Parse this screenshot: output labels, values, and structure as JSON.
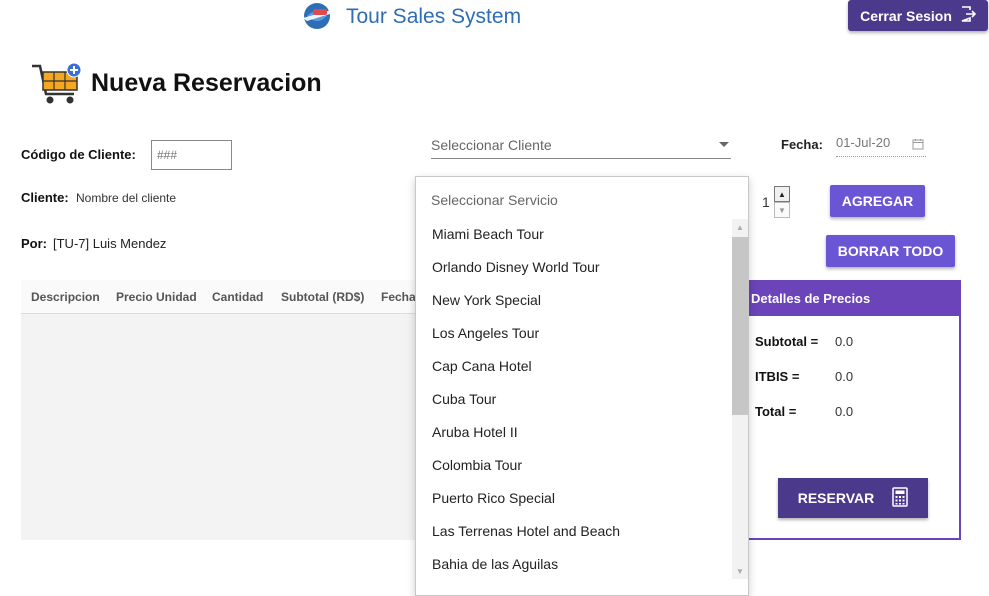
{
  "header": {
    "app_title": "Tour Sales System",
    "logout_label": "Cerrar Sesion"
  },
  "page": {
    "title": "Nueva Reservacion"
  },
  "form": {
    "codigo_label": "Código de Cliente:",
    "codigo_placeholder": "###",
    "cliente_label": "Cliente:",
    "cliente_value": "Nombre del cliente",
    "por_label": "Por:",
    "por_value": "[TU-7] Luis Mendez",
    "client_select_placeholder": "Seleccionar Cliente",
    "fecha_label": "Fecha:",
    "fecha_value": "01-Jul-20",
    "quantity": "1",
    "add_button": "AGREGAR",
    "clear_button": "BORRAR TODO"
  },
  "table": {
    "columns": [
      "Descripcion",
      "Precio Unidad",
      "Cantidad",
      "Subtotal (RD$)",
      "Fecha I"
    ]
  },
  "price_panel": {
    "title": "Detalles de Precios",
    "subtotal_label": "Subtotal =",
    "subtotal_value": "0.0",
    "itbis_label": "ITBIS =",
    "itbis_value": "0.0",
    "total_label": "Total =",
    "total_value": "0.0",
    "reserve_button": "RESERVAR"
  },
  "service_dropdown": {
    "placeholder": "Seleccionar Servicio",
    "items": [
      "Miami Beach Tour",
      "Orlando Disney World Tour",
      "New York Special",
      "Los Angeles Tour",
      "Cap Cana Hotel",
      "Cuba Tour",
      "Aruba Hotel II",
      "Colombia Tour",
      "Puerto Rico Special",
      "Las Terrenas Hotel and Beach",
      "Bahia de las Aguilas"
    ]
  },
  "colors": {
    "brand_blue": "#2f6db5",
    "dark_purple": "#4b3a8c",
    "accent_purple": "#6a55d4",
    "panel_purple": "#6a44b8"
  }
}
